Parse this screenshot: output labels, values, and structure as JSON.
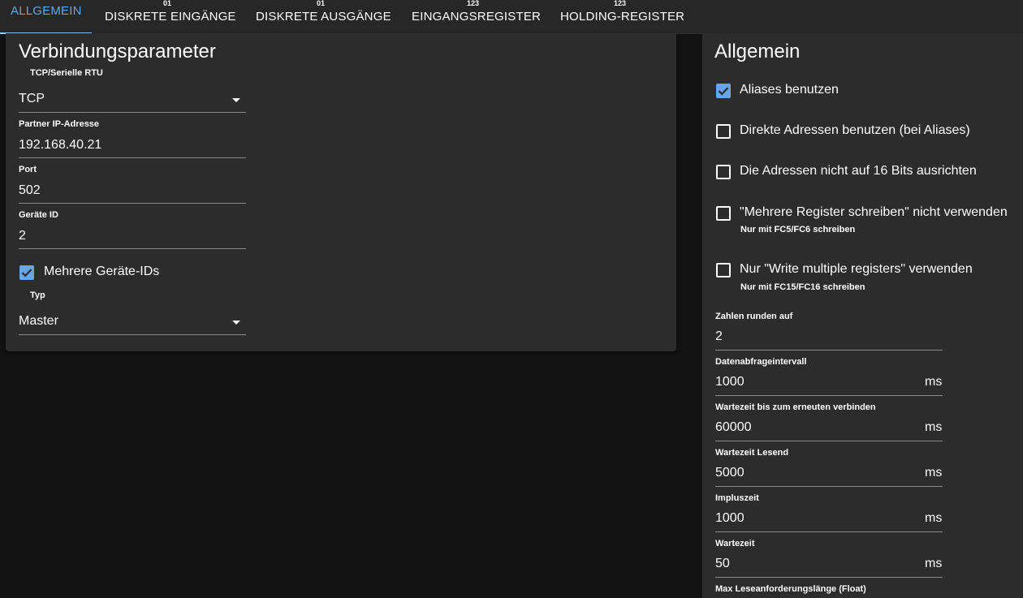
{
  "tabs": [
    {
      "label": "ALLGEMEIN",
      "icon": ""
    },
    {
      "label": "DISKRETE EINGÄNGE",
      "icon": "01"
    },
    {
      "label": "DISKRETE AUSGÄNGE",
      "icon": "01"
    },
    {
      "label": "EINGANGSREGISTER",
      "icon": "123"
    },
    {
      "label": "HOLDING-REGISTER",
      "icon": "123"
    }
  ],
  "accent_color": "#64a6e8",
  "left": {
    "title": "Verbindungsparameter",
    "mode_label": "TCP/Serielle RTU",
    "mode_value": "TCP",
    "ip_label": "Partner IP-Adresse",
    "ip_value": "192.168.40.21",
    "port_label": "Port",
    "port_value": "502",
    "device_label": "Geräte ID",
    "device_value": "2",
    "multi_label": "Mehrere Geräte-IDs",
    "multi_checked": true,
    "type_label": "Typ",
    "type_value": "Master"
  },
  "right": {
    "title": "Allgemein",
    "checkboxes": [
      {
        "label": "Aliases benutzen",
        "checked": true,
        "hint": ""
      },
      {
        "label": "Direkte Adressen benutzen (bei Aliases)",
        "checked": false,
        "hint": ""
      },
      {
        "label": "Die Adressen nicht auf 16 Bits ausrichten",
        "checked": false,
        "hint": ""
      },
      {
        "label": "\"Mehrere Register schreiben\" nicht verwenden",
        "checked": false,
        "hint": "Nur mit FC5/FC6 schreiben"
      },
      {
        "label": "Nur \"Write multiple registers\" verwenden",
        "checked": false,
        "hint": "Nur mit FC15/FC16 schreiben"
      }
    ],
    "fields": [
      {
        "label": "Zahlen runden auf",
        "value": "2",
        "unit": ""
      },
      {
        "label": "Datenabfrageintervall",
        "value": "1000",
        "unit": "ms"
      },
      {
        "label": "Wartezeit bis zum erneuten verbinden",
        "value": "60000",
        "unit": "ms"
      },
      {
        "label": "Wartezeit Lesend",
        "value": "5000",
        "unit": "ms"
      },
      {
        "label": "Impluszeit",
        "value": "1000",
        "unit": "ms"
      },
      {
        "label": "Wartezeit",
        "value": "50",
        "unit": "ms"
      },
      {
        "label": "Max Leseanforderungslänge (Float)",
        "value": "",
        "unit": ""
      }
    ]
  }
}
